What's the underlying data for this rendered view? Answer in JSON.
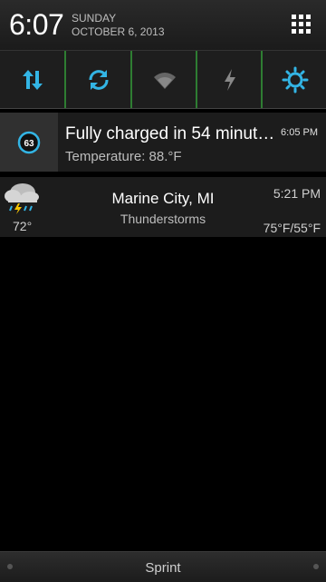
{
  "status": {
    "time": "6:07",
    "day": "SUNDAY",
    "date": "OCTOBER 6, 2013"
  },
  "quick_settings": [
    {
      "icon": "mobile-data-icon",
      "color": "#33b5e5"
    },
    {
      "icon": "sync-icon",
      "color": "#33b5e5"
    },
    {
      "icon": "wifi-icon",
      "color": "#777777"
    },
    {
      "icon": "flash-icon",
      "color": "#777777"
    },
    {
      "icon": "brightness-icon",
      "color": "#33b5e5"
    }
  ],
  "battery_notification": {
    "level": "63",
    "title": "Fully charged in 54 minut…",
    "subtitle": "Temperature: 88.°F",
    "time": "6:05 PM"
  },
  "weather_notification": {
    "current_temp": "72°",
    "city": "Marine City, MI",
    "condition": "Thunderstorms",
    "time": "5:21 PM",
    "range": "75°F/55°F",
    "icon": "thunderstorm-icon"
  },
  "bottom_bar": {
    "carrier": "Sprint"
  }
}
